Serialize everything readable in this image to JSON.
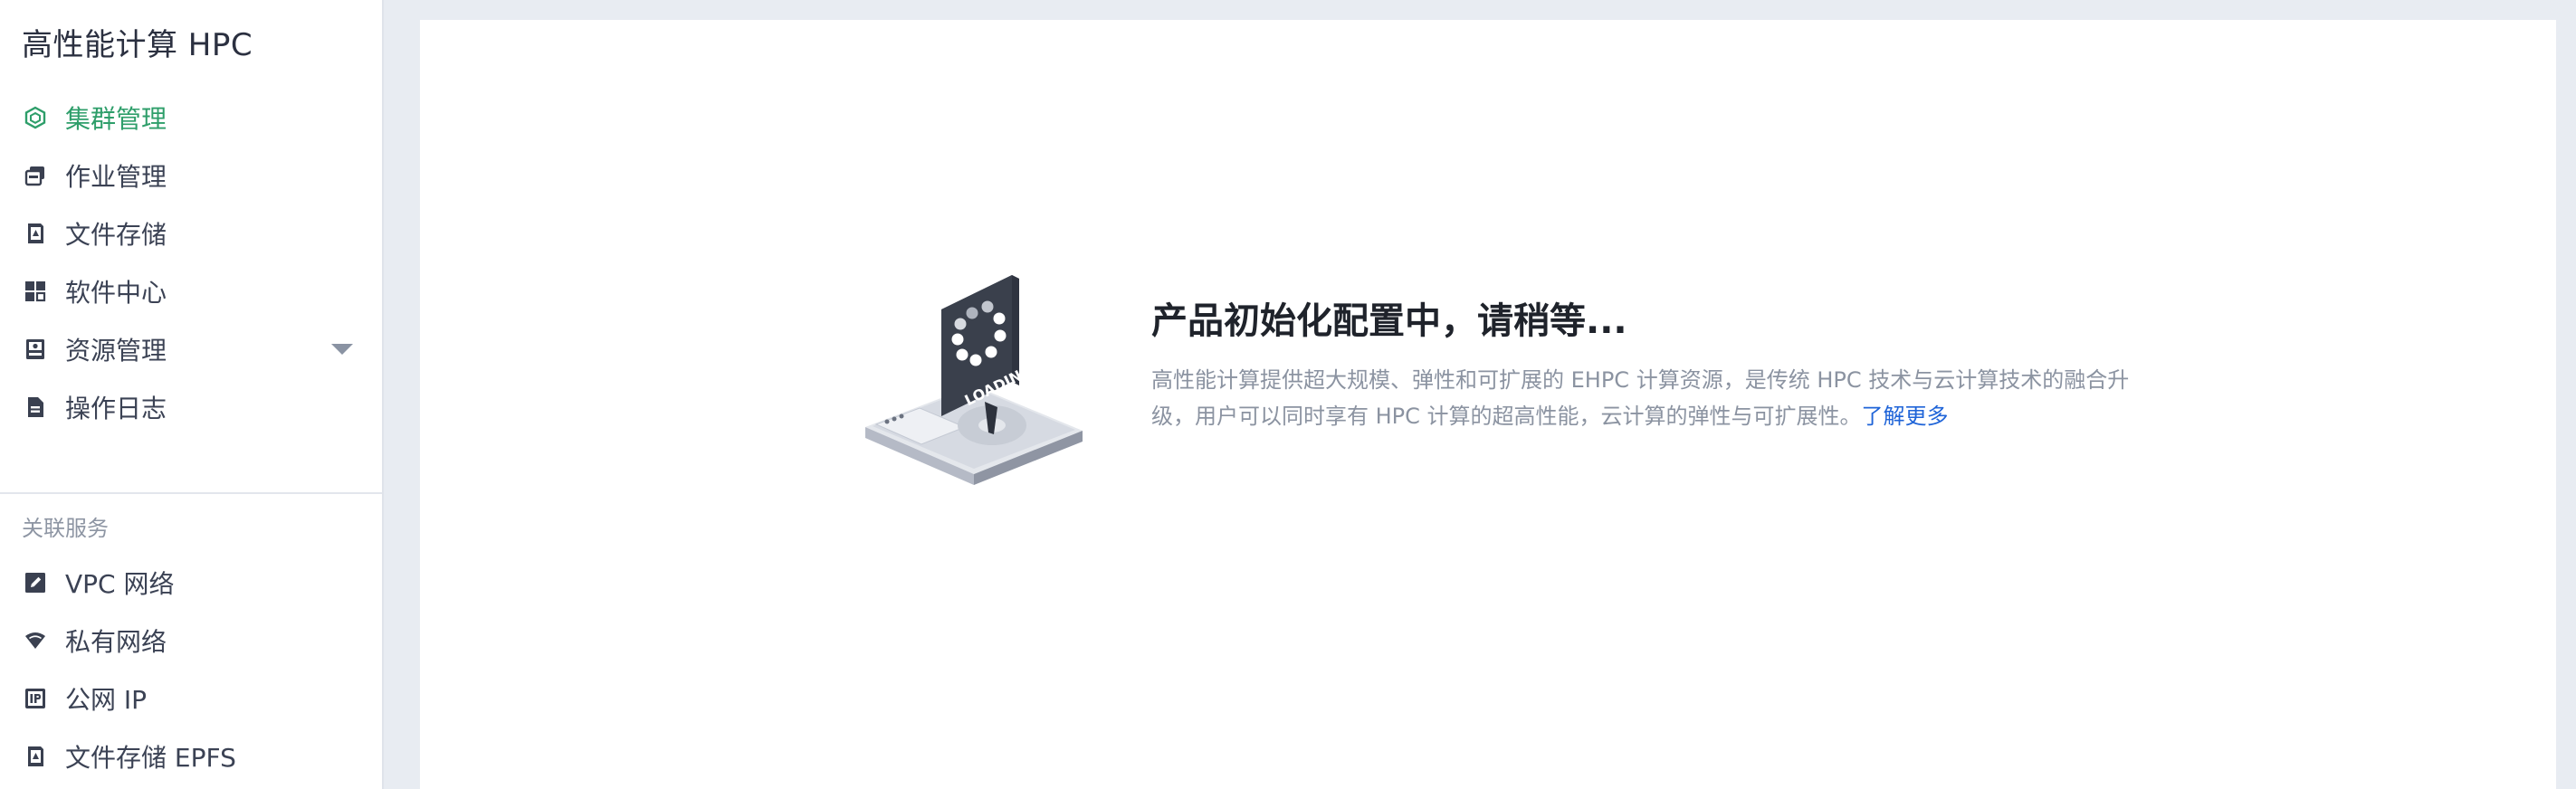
{
  "sidebar": {
    "title": "高性能计算 HPC",
    "items": [
      {
        "label": "集群管理",
        "icon": "cluster-hexagon-icon",
        "active": true
      },
      {
        "label": "作业管理",
        "icon": "job-stack-icon"
      },
      {
        "label": "文件存储",
        "icon": "file-storage-icon"
      },
      {
        "label": "软件中心",
        "icon": "apps-grid-icon"
      },
      {
        "label": "资源管理",
        "icon": "resource-card-icon",
        "expandable": true
      },
      {
        "label": "操作日志",
        "icon": "log-document-icon"
      }
    ],
    "related_title": "关联服务",
    "related_items": [
      {
        "label": "VPC 网络",
        "icon": "vpc-edit-icon"
      },
      {
        "label": "私有网络",
        "icon": "wifi-network-icon"
      },
      {
        "label": "公网 IP",
        "icon": "public-ip-icon"
      },
      {
        "label": "文件存储 EPFS",
        "icon": "epfs-storage-icon"
      }
    ]
  },
  "main": {
    "loading_title": "产品初始化配置中，请稍等...",
    "description": "高性能计算提供超大规模、弹性和可扩展的 EHPC 计算资源，是传统 HPC 技术与云计算技术的融合升级，用户可以同时享有 HPC 计算的超高性能，云计算的弹性与可扩展性。",
    "learn_more": "了解更多",
    "illustration_text": "LOADING"
  },
  "colors": {
    "accent_green": "#2e9e6a",
    "link_blue": "#1f64d8",
    "text_dark": "#3b4254",
    "muted": "#8b93a1",
    "page_bg": "#e8ecf2"
  }
}
